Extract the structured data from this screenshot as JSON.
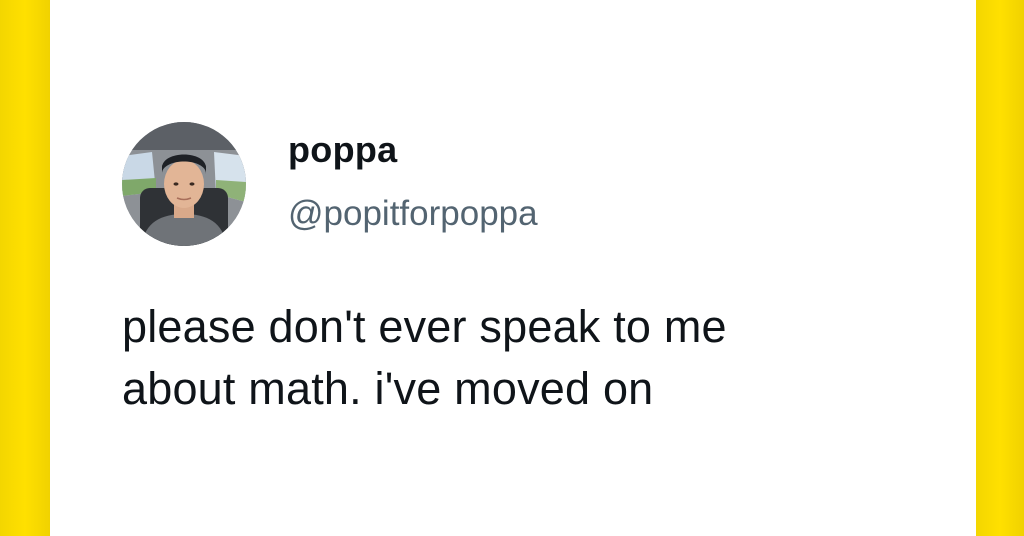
{
  "tweet": {
    "author": {
      "display_name": "poppa",
      "handle": "@popitforpoppa",
      "avatar_icon": "profile-photo"
    },
    "text_lines": [
      "please don't ever speak to me",
      "about math. i've moved on"
    ]
  },
  "colors": {
    "frame": "#ffe000",
    "card_background": "#ffffff",
    "name_text": "#0f1419",
    "handle_text": "#536471",
    "body_text": "#0f1419"
  }
}
